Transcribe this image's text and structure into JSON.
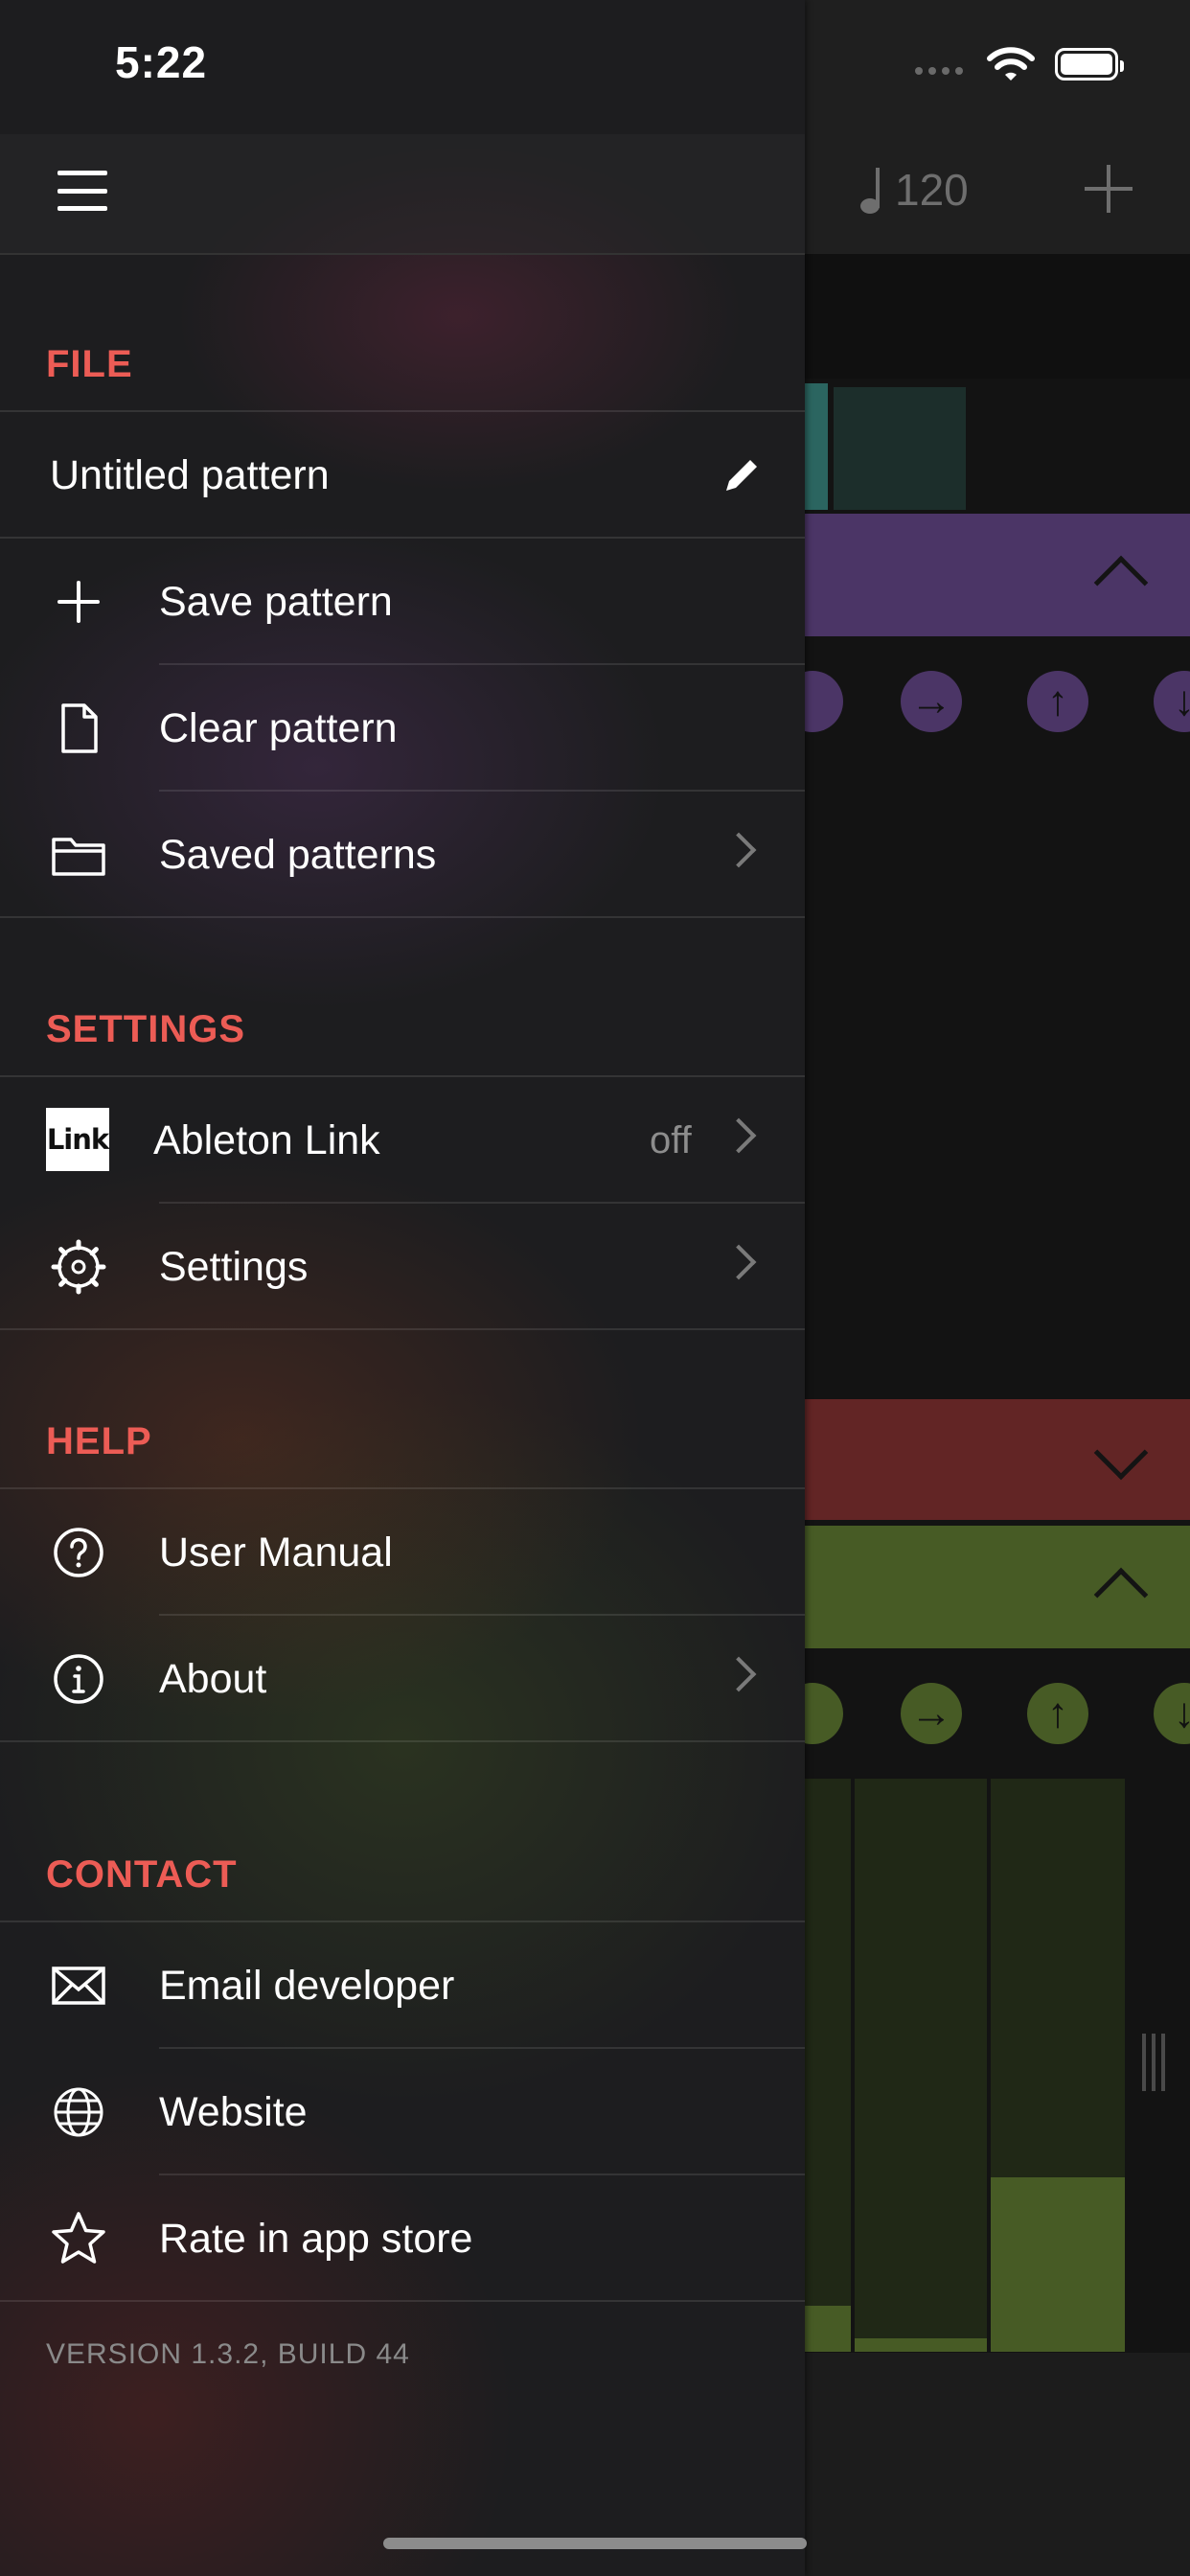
{
  "status_bar": {
    "time": "5:22"
  },
  "background_app": {
    "tempo": "120",
    "arrow_buttons": [
      "→",
      "↑",
      "↓"
    ]
  },
  "drawer": {
    "sections": {
      "file": {
        "title": "FILE",
        "pattern_name": "Untitled pattern",
        "items": [
          {
            "label": "Save pattern",
            "icon": "plus-icon"
          },
          {
            "label": "Clear pattern",
            "icon": "document-icon"
          },
          {
            "label": "Saved patterns",
            "icon": "folder-icon"
          }
        ]
      },
      "settings": {
        "title": "SETTINGS",
        "link_logo_text": "Link",
        "items": [
          {
            "label": "Ableton Link",
            "value": "off",
            "icon": "ableton-link-logo"
          },
          {
            "label": "Settings",
            "icon": "gear-icon"
          }
        ]
      },
      "help": {
        "title": "HELP",
        "items": [
          {
            "label": "User Manual",
            "icon": "question-circle-icon"
          },
          {
            "label": "About",
            "icon": "info-circle-icon"
          }
        ]
      },
      "contact": {
        "title": "CONTACT",
        "items": [
          {
            "label": "Email developer",
            "icon": "envelope-icon"
          },
          {
            "label": "Website",
            "icon": "globe-icon"
          },
          {
            "label": "Rate in app store",
            "icon": "star-icon"
          }
        ]
      }
    },
    "version": "VERSION 1.3.2, BUILD 44"
  },
  "colors": {
    "section_title": "#ec5c55",
    "band_purple": "#4b3566",
    "band_red": "#622525",
    "band_green": "#475b25"
  }
}
